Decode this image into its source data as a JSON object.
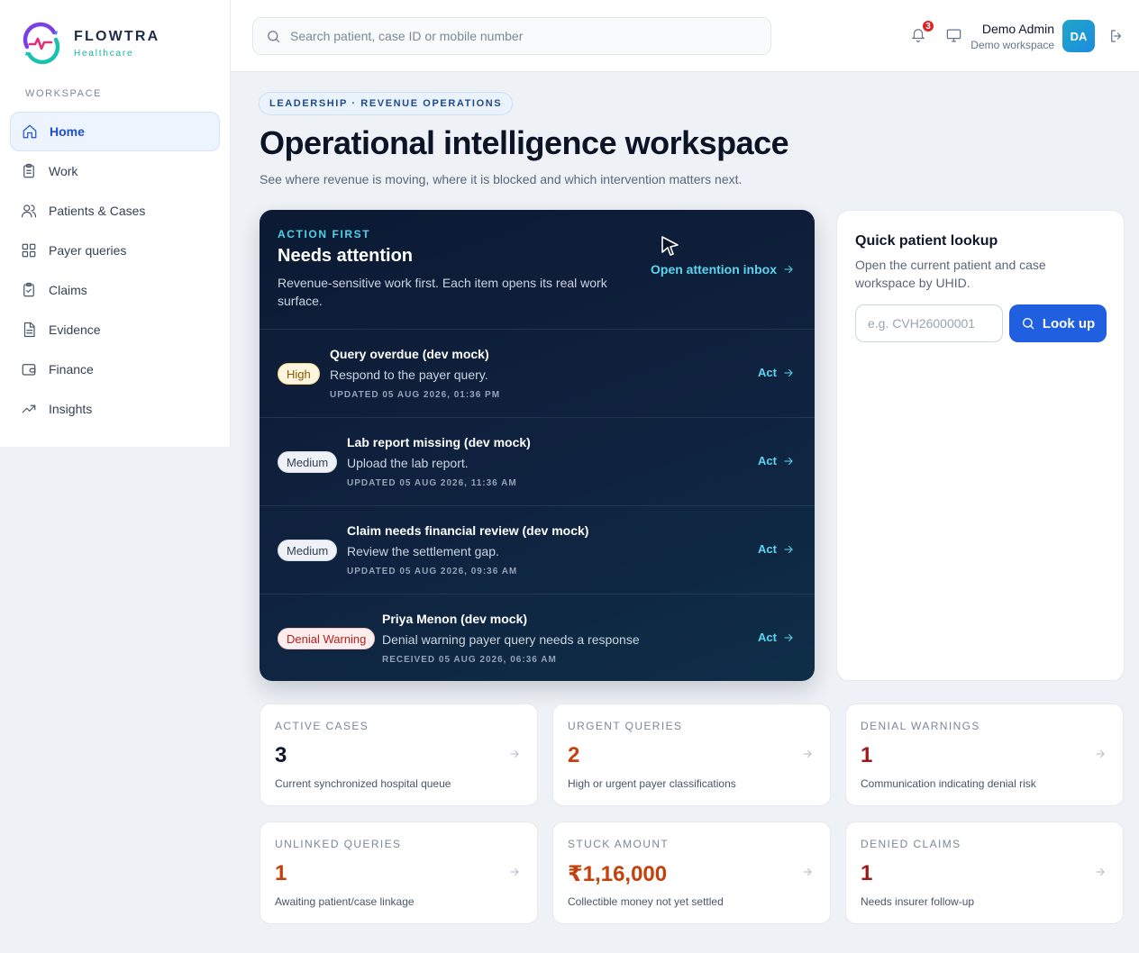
{
  "brand": {
    "name": "FLOWTRA",
    "sub": "Healthcare"
  },
  "sidebar": {
    "section_label": "WORKSPACE",
    "items": [
      {
        "label": "Home",
        "icon": "home-icon"
      },
      {
        "label": "Work",
        "icon": "clipboard-icon"
      },
      {
        "label": "Patients & Cases",
        "icon": "users-icon"
      },
      {
        "label": "Payer queries",
        "icon": "grid-icon"
      },
      {
        "label": "Claims",
        "icon": "clipboard-check-icon"
      },
      {
        "label": "Evidence",
        "icon": "file-icon"
      },
      {
        "label": "Finance",
        "icon": "wallet-icon"
      },
      {
        "label": "Insights",
        "icon": "trending-up-icon"
      }
    ]
  },
  "topbar": {
    "search_placeholder": "Search patient, case ID or mobile number",
    "notification_count": "3",
    "user_name": "Demo Admin",
    "user_workspace": "Demo workspace",
    "avatar_initials": "DA"
  },
  "header": {
    "eyebrow": "LEADERSHIP · REVENUE OPERATIONS",
    "title": "Operational intelligence workspace",
    "subtitle": "See where revenue is moving, where it is blocked and which intervention matters next."
  },
  "attention": {
    "eyebrow": "ACTION FIRST",
    "title": "Needs attention",
    "description": "Revenue-sensitive work first. Each item opens its real work surface.",
    "inbox_link": "Open attention inbox",
    "items": [
      {
        "priority": "High",
        "priority_kind": "high",
        "title": "Query overdue (dev mock)",
        "desc": "Respond to the payer query.",
        "time": "UPDATED 05 AUG 2026, 01:36 PM",
        "action": "Act"
      },
      {
        "priority": "Medium",
        "priority_kind": "medium",
        "title": "Lab report missing (dev mock)",
        "desc": "Upload the lab report.",
        "time": "UPDATED 05 AUG 2026, 11:36 AM",
        "action": "Act"
      },
      {
        "priority": "Medium",
        "priority_kind": "medium",
        "title": "Claim needs financial review (dev mock)",
        "desc": "Review the settlement gap.",
        "time": "UPDATED 05 AUG 2026, 09:36 AM",
        "action": "Act"
      },
      {
        "priority": "Denial Warning",
        "priority_kind": "denial",
        "title": "Priya Menon (dev mock)",
        "desc": "Denial warning payer query needs a response",
        "time": "RECEIVED 05 AUG 2026, 06:36 AM",
        "action": "Act"
      }
    ]
  },
  "lookup": {
    "title": "Quick patient lookup",
    "description": "Open the current patient and case workspace by UHID.",
    "placeholder": "e.g. CVH26000001",
    "button": "Look up"
  },
  "metrics": [
    {
      "label": "ACTIVE CASES",
      "value": "3",
      "desc": "Current synchronized hospital queue",
      "color": "#0f172a"
    },
    {
      "label": "URGENT QUERIES",
      "value": "2",
      "desc": "High or urgent payer classifications",
      "color": "#c2410c"
    },
    {
      "label": "DENIAL WARNINGS",
      "value": "1",
      "desc": "Communication indicating denial risk",
      "color": "#991b1b"
    },
    {
      "label": "UNLINKED QUERIES",
      "value": "1",
      "desc": "Awaiting patient/case linkage",
      "color": "#c2410c"
    },
    {
      "label": "STUCK AMOUNT",
      "value": "₹1,16,000",
      "desc": "Collectible money not yet settled",
      "color": "#c2410c"
    },
    {
      "label": "DENIED CLAIMS",
      "value": "1",
      "desc": "Needs insurer follow-up",
      "color": "#991b1b"
    }
  ]
}
